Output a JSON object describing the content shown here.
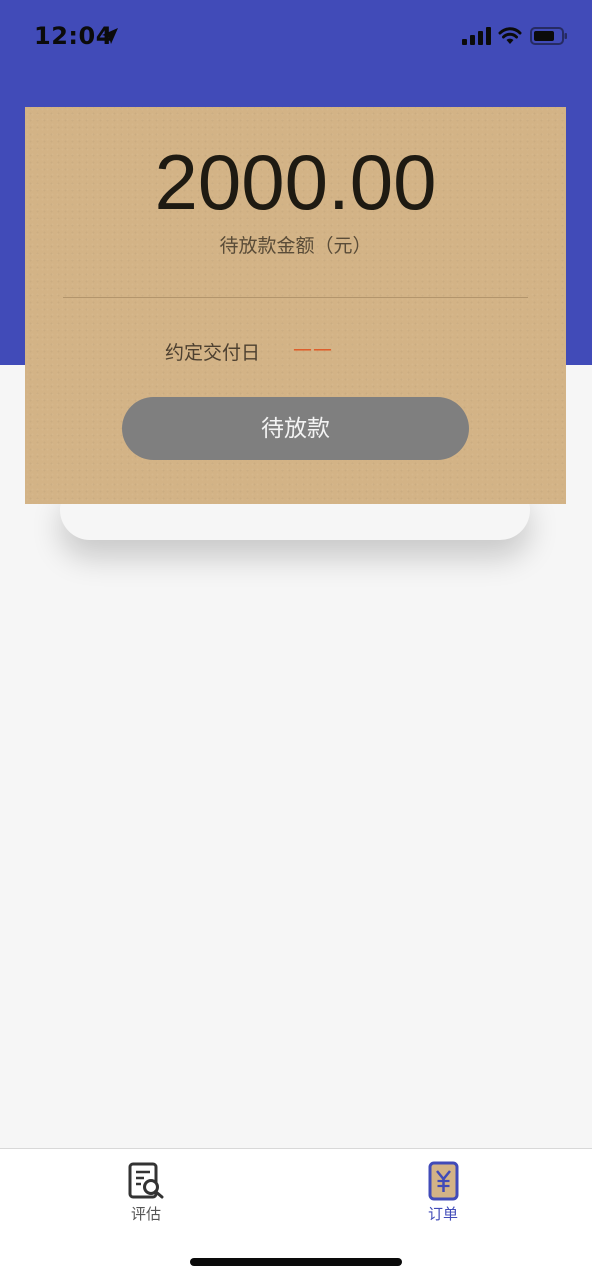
{
  "status_bar": {
    "time": "12:04"
  },
  "card": {
    "amount": "2000.00",
    "amount_label": "待放款金额（元）",
    "due_date_label": "约定交付日",
    "due_date_value": "——",
    "button_label": "待放款"
  },
  "tab_bar": {
    "tabs": [
      {
        "label": "评估",
        "icon": "document-search-icon",
        "active": false
      },
      {
        "label": "订单",
        "icon": "yuan-order-icon",
        "active": true
      }
    ]
  },
  "colors": {
    "header": "#414bb8",
    "card": "#d3b386",
    "button": "#7f7f7f",
    "active_tab": "#414bb8",
    "due_value": "#e0531f"
  }
}
